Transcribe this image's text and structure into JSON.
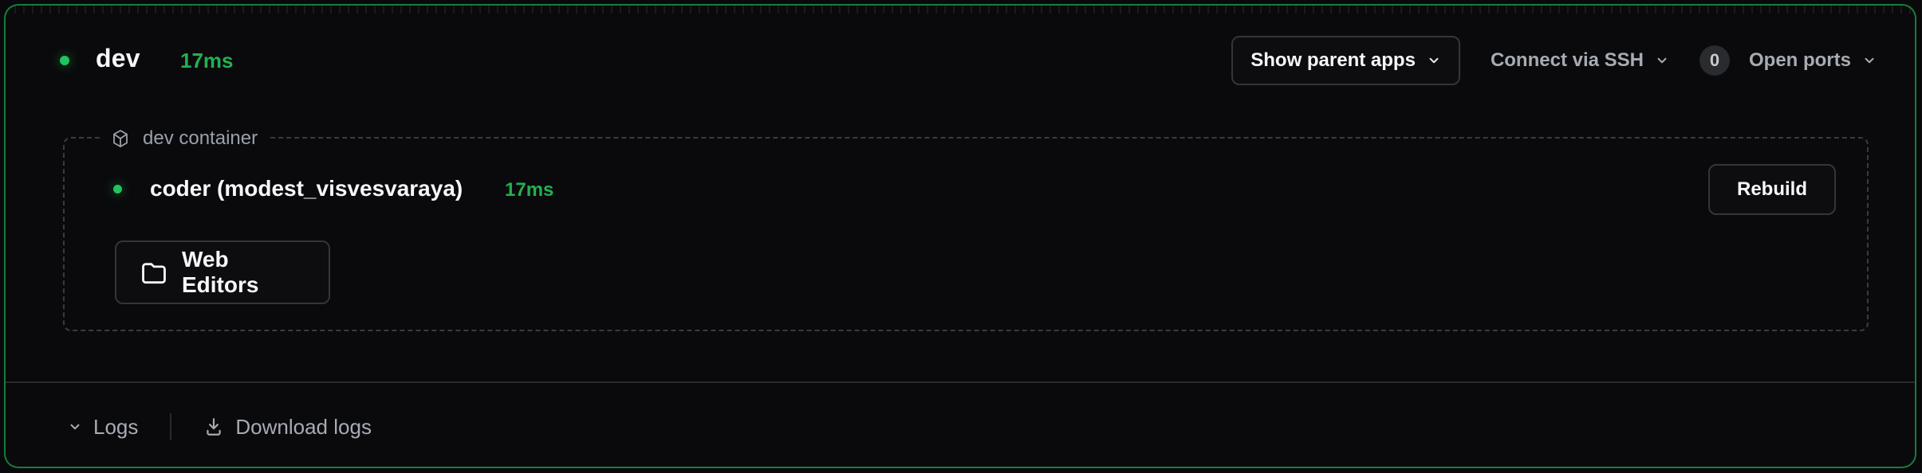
{
  "workspace": {
    "name": "dev",
    "latency": "17ms"
  },
  "header": {
    "show_parent_apps": "Show parent apps",
    "connect_via_ssh": "Connect via SSH",
    "open_ports_count": "0",
    "open_ports_label": "Open ports"
  },
  "dev_container": {
    "label": "dev container",
    "agent_name": "coder (modest_visvesvaraya)",
    "agent_latency": "17ms",
    "rebuild_label": "Rebuild",
    "web_editors_label": "Web Editors"
  },
  "footer": {
    "logs_label": "Logs",
    "download_logs_label": "Download logs"
  },
  "icons": {
    "chevron_down": "chevron-down-icon",
    "cube": "cube-icon",
    "folder": "folder-icon",
    "download": "download-icon"
  },
  "colors": {
    "accent": "#21c45d",
    "latency": "#23b04f",
    "background": "#0a0a0c",
    "border": "#34353a"
  }
}
